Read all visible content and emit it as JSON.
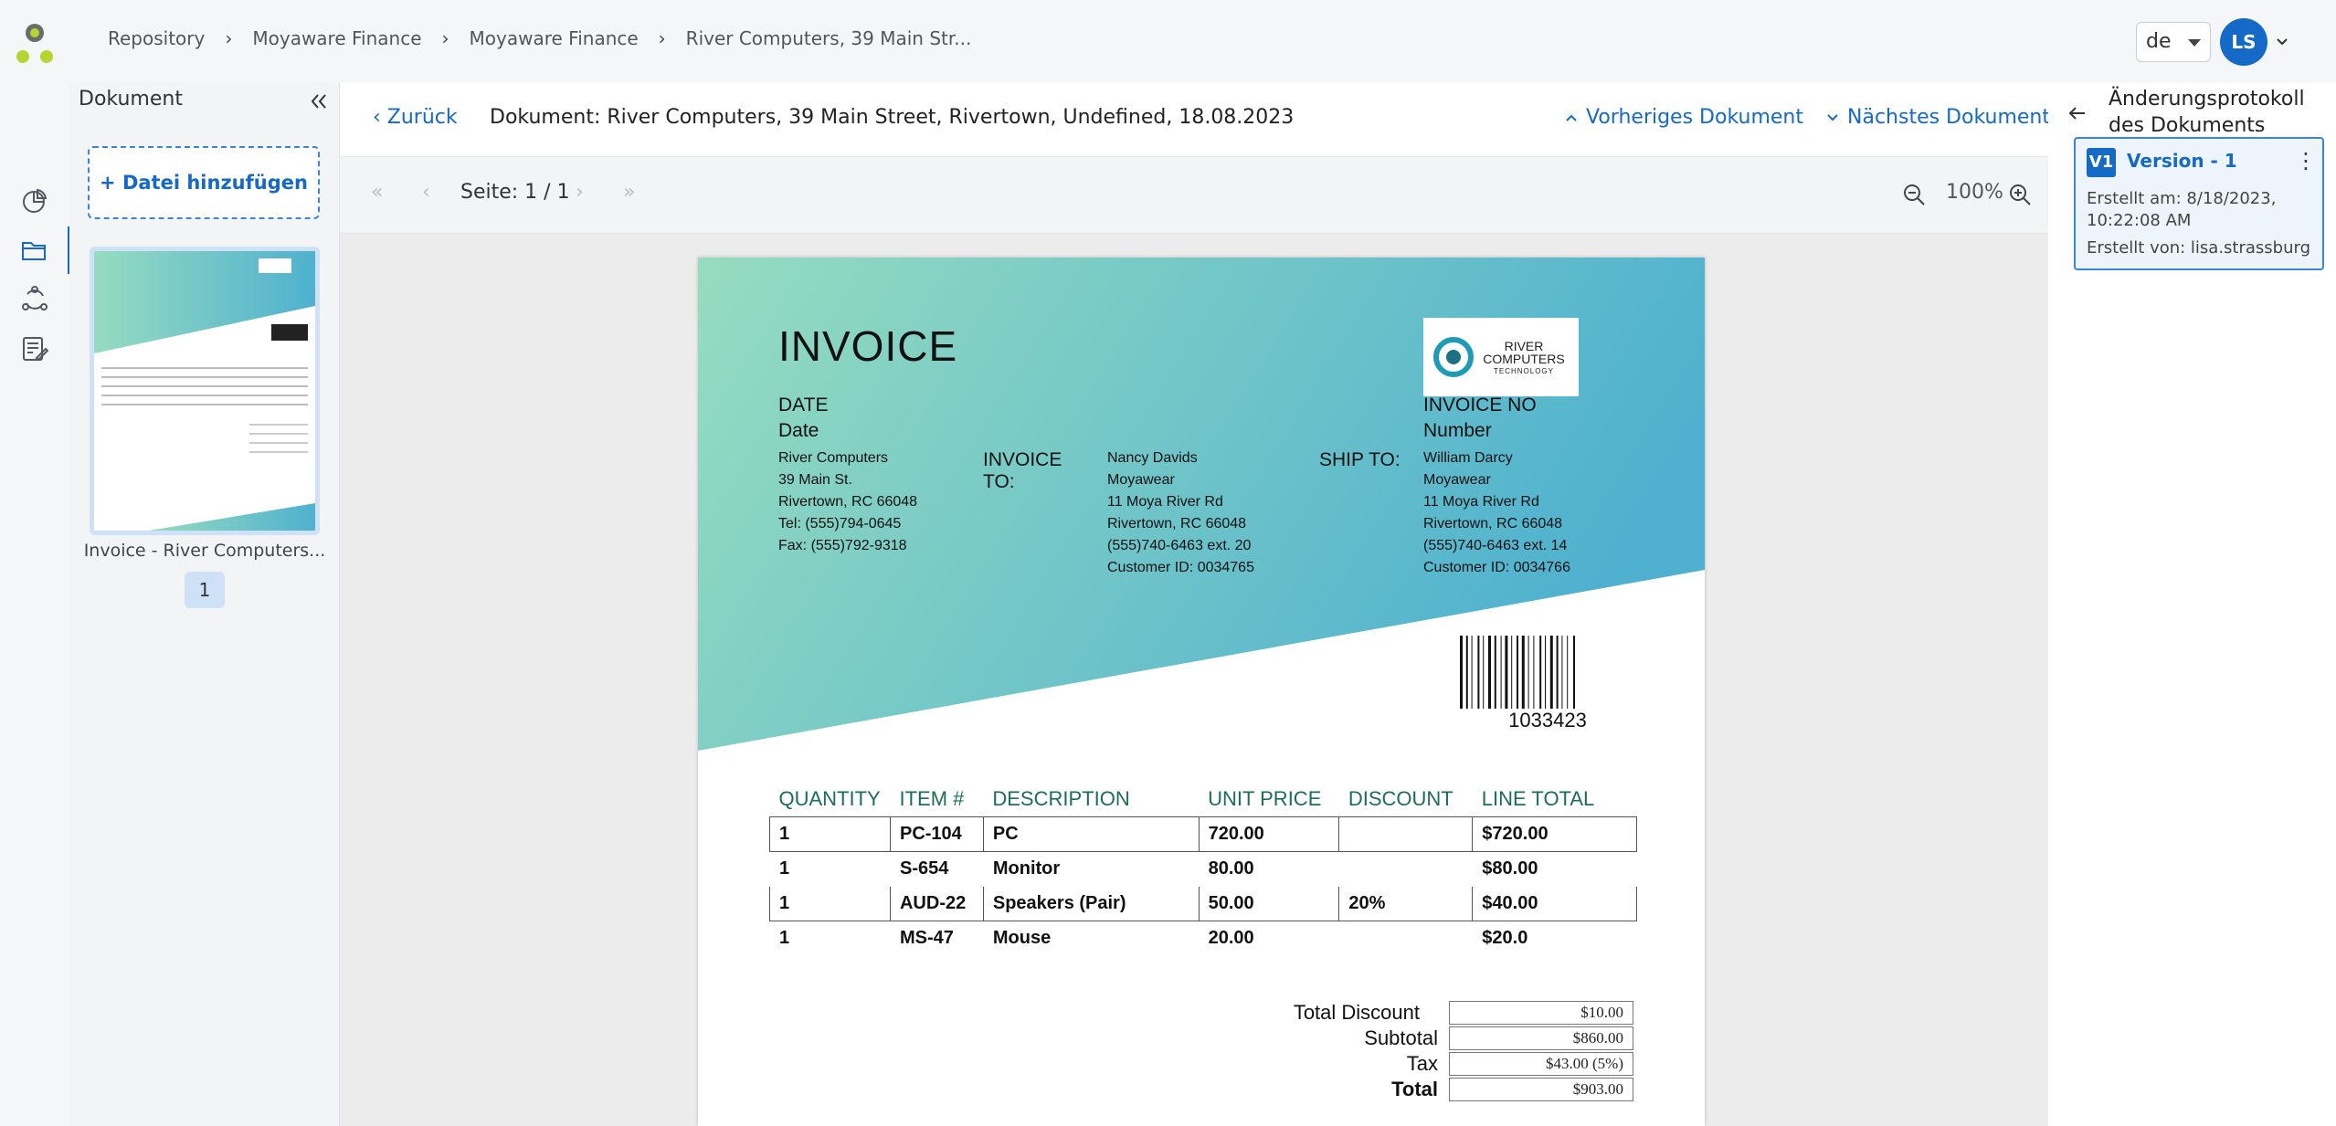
{
  "breadcrumbs": [
    "Repository",
    "Moyaware Finance",
    "Moyaware Finance",
    "River Computers, 39 Main Str..."
  ],
  "header": {
    "language": "de",
    "avatar_initials": "LS"
  },
  "doc_panel": {
    "title": "Dokument",
    "add_file": "+ Datei hinzufügen",
    "thumb_name": "Invoice - River Computers...",
    "page_badge": "1"
  },
  "doc_header": {
    "back": "Zurück",
    "title": "Dokument: River Computers, 39 Main Street, Rivertown, Undefined, 18.08.2023",
    "prev": "Vorheriges Dokument",
    "next": "Nächstes Dokument"
  },
  "toolbar": {
    "page_info": "Seite: 1 / 1",
    "zoom": "100%"
  },
  "invoice": {
    "heading": "INVOICE",
    "date_label": "DATE",
    "date_value": "Date",
    "invoice_no_label": "INVOICE NO",
    "invoice_no_value": "Number",
    "invoice_to_label": "INVOICE\nTO:",
    "ship_to_label": "SHIP TO:",
    "from_block": "River Computers\n39 Main St.\nRivertown, RC 66048\nTel: (555)794-0645\nFax: (555)792-9318",
    "to_block": "Nancy Davids\nMoyawear\n11 Moya River Rd\nRivertown, RC 66048\n(555)740-6463 ext. 20\nCustomer ID: 0034765",
    "ship_block": "William Darcy\nMoyawear\n11 Moya River Rd\nRivertown, RC 66048\n(555)740-6463 ext. 14\nCustomer ID: 0034766",
    "logo_line1": "RIVER",
    "logo_line2": "COMPUTERS",
    "logo_line3": "TECHNOLOGY",
    "barcode_number": "1033423",
    "columns": [
      "QUANTITY",
      "ITEM #",
      "DESCRIPTION",
      "UNIT PRICE",
      "DISCOUNT",
      "LINE TOTAL"
    ],
    "rows": [
      [
        "1",
        "PC-104",
        "PC",
        "720.00",
        "",
        "$720.00"
      ],
      [
        "1",
        "S-654",
        "Monitor",
        "80.00",
        "",
        "$80.00"
      ],
      [
        "1",
        "AUD-22",
        "Speakers (Pair)",
        "50.00",
        "20%",
        "$40.00"
      ],
      [
        "1",
        "MS-47",
        "Mouse",
        "20.00",
        "",
        "$20.0"
      ]
    ],
    "totals": {
      "discount_label": "Total Discount",
      "discount_value": "$10.00",
      "subtotal_label": "Subtotal",
      "subtotal_value": "$860.00",
      "tax_label": "Tax",
      "tax_value": "$43.00 (5%)",
      "total_label": "Total",
      "total_value": "$903.00"
    }
  },
  "right_panel": {
    "title": "Änderungsprotokoll des Dokuments",
    "version_badge": "V1",
    "version_label": "Version - 1",
    "created_at": "Erstellt am: 8/18/2023, 10:22:08 AM",
    "created_by": "Erstellt von: lisa.strassburg"
  },
  "colors": {
    "accent": "#1569c7",
    "gradient_start": "#96dcc0",
    "gradient_end": "#4fb1cf",
    "table_header": "#1d6e54"
  }
}
